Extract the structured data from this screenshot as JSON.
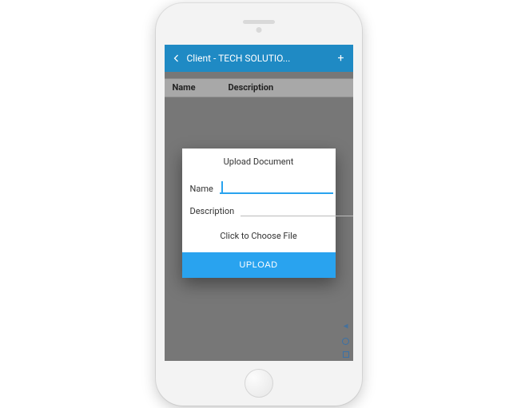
{
  "header": {
    "title": "Client - TECH SOLUTIO..."
  },
  "table": {
    "col_name": "Name",
    "col_description": "Description"
  },
  "dialog": {
    "title": "Upload Document",
    "name_label": "Name",
    "name_value": "",
    "description_label": "Description",
    "description_value": "",
    "choose_file_label": "Click to Choose File",
    "upload_button": "UPLOAD"
  },
  "colors": {
    "header_bg": "#1f8ac4",
    "accent": "#29a3ef"
  }
}
